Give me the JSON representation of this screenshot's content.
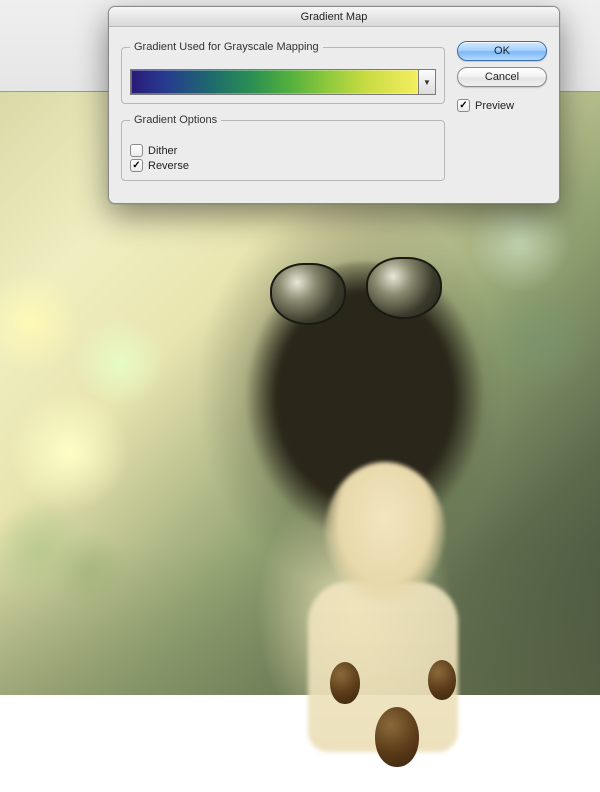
{
  "dialog": {
    "title": "Gradient Map",
    "group_gradient_legend": "Gradient Used for Grayscale Mapping",
    "group_options_legend": "Gradient Options",
    "dither_label": "Dither",
    "dither_checked": false,
    "reverse_label": "Reverse",
    "reverse_checked": true
  },
  "buttons": {
    "ok": "OK",
    "cancel": "Cancel"
  },
  "preview": {
    "label": "Preview",
    "checked": true
  },
  "gradient": {
    "stops": [
      "#2a1a78",
      "#1e6a6d",
      "#52af3e",
      "#f4ee5e"
    ]
  }
}
